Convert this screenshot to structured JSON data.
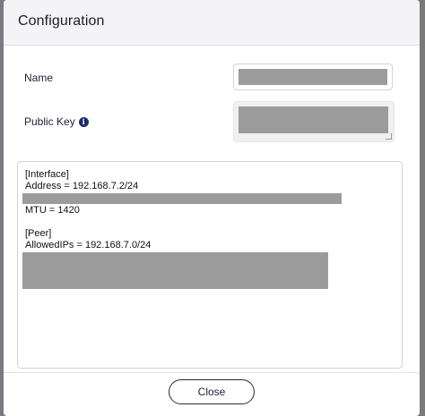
{
  "modal": {
    "title": "Configuration",
    "name_label": "Name",
    "public_key_label": "Public Key",
    "info_icon_glyph": "i",
    "close_label": "Close"
  },
  "config_text": {
    "line1": "[Interface]",
    "line2": "Address = 192.168.7.2/24",
    "line3": "MTU = 1420",
    "line4": "[Peer]",
    "line5": "AllowedIPs = 192.168.7.0/24"
  },
  "colors": {
    "accent": "#1f2a6b",
    "redaction": "#9b9b9b"
  },
  "icons": {
    "info": "info-icon"
  }
}
